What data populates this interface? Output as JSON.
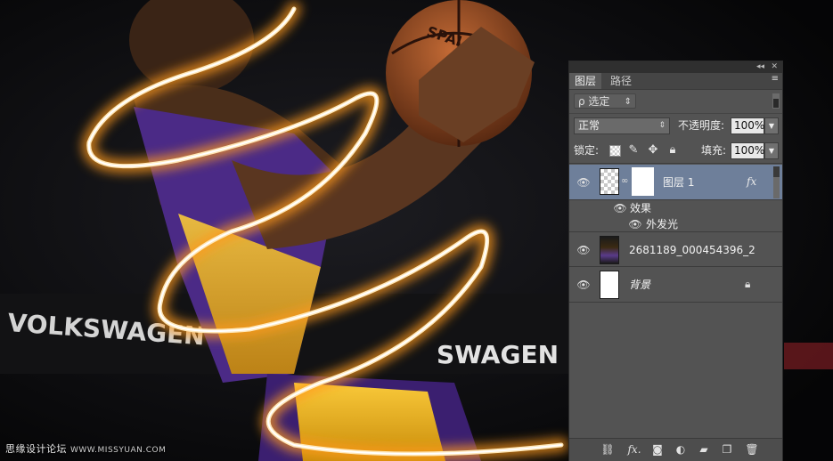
{
  "watermark": {
    "text": "思缘设计论坛",
    "url": "WWW.MISSYUAN.COM"
  },
  "scene": {
    "banner_left": "VOLKSWAGEN",
    "banner_right": "SWAGEN",
    "ball_text": "SPALDING",
    "colors": {
      "glow": "#ffb23a",
      "jersey_purple": "#4b2a86",
      "jersey_gold": "#f3b21a"
    }
  },
  "panel": {
    "title_controls": {
      "collapse": "◂◂",
      "close": "✕"
    },
    "tabs": [
      {
        "label": "图层",
        "active": true
      },
      {
        "label": "路径",
        "active": false
      }
    ],
    "menu_icon": "≡",
    "filter": {
      "kind_label": "ρ 选定",
      "arrows": "⇕"
    },
    "blend": {
      "mode": "正常",
      "opacity_label": "不透明度:",
      "opacity_value": "100%"
    },
    "lock": {
      "label": "锁定:",
      "fill_label": "填充:",
      "fill_value": "100%"
    },
    "layers": [
      {
        "name": "图层 1",
        "fx": "fx",
        "selected": true
      },
      {
        "name": "效果",
        "kind": "effect-group"
      },
      {
        "name": "外发光",
        "kind": "effect"
      },
      {
        "name": "2681189_000454396_2"
      },
      {
        "name": "背景",
        "locked": true
      }
    ],
    "footer_icons": [
      "link-icon",
      "fx-icon",
      "mask-icon",
      "adjustment-icon",
      "group-folder-icon",
      "new-layer-icon",
      "trash-icon"
    ]
  }
}
